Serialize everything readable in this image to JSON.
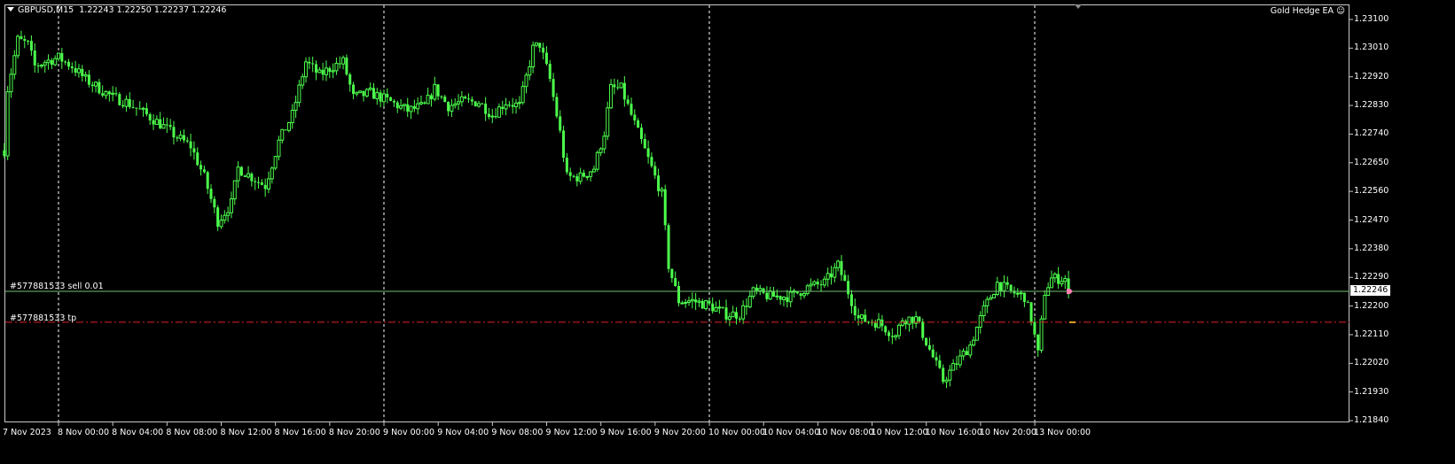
{
  "header": {
    "symbol_timeframe": "GBPUSD,M15",
    "ohlc": "1.22243 1.22250 1.22237 1.22246",
    "expert_name": "Gold Hedge EA",
    "expert_icon": "smiley-face-icon"
  },
  "colors": {
    "background": "#000000",
    "candle": "#4cff4c",
    "order_line": "#6fbf6f",
    "tp_line": "#e0202a",
    "grid_separator": "#ffffff"
  },
  "price_axis": {
    "labels": [
      "1.23100",
      "1.23010",
      "1.22920",
      "1.22830",
      "1.22740",
      "1.22650",
      "1.22560",
      "1.22470",
      "1.22380",
      "1.22290",
      "1.22200",
      "1.22110",
      "1.22020",
      "1.21930",
      "1.21840"
    ],
    "current_price": "1.22246",
    "range": [
      1.2184,
      1.231
    ]
  },
  "time_axis": {
    "labels": [
      "7 Nov 2023",
      "8 Nov 00:00",
      "8 Nov 04:00",
      "8 Nov 08:00",
      "8 Nov 12:00",
      "8 Nov 16:00",
      "8 Nov 20:00",
      "9 Nov 00:00",
      "9 Nov 04:00",
      "9 Nov 08:00",
      "9 Nov 12:00",
      "9 Nov 16:00",
      "9 Nov 20:00",
      "10 Nov 00:00",
      "10 Nov 04:00",
      "10 Nov 08:00",
      "10 Nov 12:00",
      "10 Nov 16:00",
      "10 Nov 20:00",
      "13 Nov 00:00"
    ],
    "day_separators": [
      "8 Nov 00:00",
      "9 Nov 00:00",
      "10 Nov 00:00",
      "13 Nov 00:00"
    ]
  },
  "orders": {
    "sell": {
      "label": "#577881533 sell 0.01",
      "price": 1.22246
    },
    "tp": {
      "label": "#577881533 tp",
      "price": 1.22149
    }
  },
  "chart_data": {
    "type": "candlestick",
    "timeframe": "M15",
    "approx_price_path": [
      [
        "7 20:00",
        1.22689
      ],
      [
        "7 20:15",
        1.22883
      ],
      [
        "7 21:00",
        1.23036
      ],
      [
        "7 21:45",
        1.23022
      ],
      [
        "7 22:15",
        1.22953
      ],
      [
        "7 23:00",
        1.22967
      ],
      [
        "8 00:00",
        1.2298
      ],
      [
        "8 01:00",
        1.22953
      ],
      [
        "8 02:00",
        1.22911
      ],
      [
        "8 03:00",
        1.22883
      ],
      [
        "8 04:00",
        1.22855
      ],
      [
        "8 05:00",
        1.22841
      ],
      [
        "8 06:00",
        1.22814
      ],
      [
        "8 07:30",
        1.22772
      ],
      [
        "8 08:45",
        1.2273
      ],
      [
        "8 09:45",
        1.22702
      ],
      [
        "8 10:45",
        1.22605
      ],
      [
        "8 11:45",
        1.22466
      ],
      [
        "8 12:45",
        1.22522
      ],
      [
        "8 13:15",
        1.22633
      ],
      [
        "8 14:15",
        1.22605
      ],
      [
        "8 15:15",
        1.22577
      ],
      [
        "8 16:15",
        1.22716
      ],
      [
        "8 17:15",
        1.228
      ],
      [
        "8 18:15",
        1.22967
      ],
      [
        "8 19:15",
        1.22925
      ],
      [
        "8 20:15",
        1.22953
      ],
      [
        "8 21:00",
        1.22967
      ],
      [
        "8 21:45",
        1.22855
      ],
      [
        "8 23:00",
        1.22869
      ],
      [
        "9 00:30",
        1.22841
      ],
      [
        "9 01:45",
        1.22814
      ],
      [
        "9 03:00",
        1.22828
      ],
      [
        "9 03:45",
        1.22883
      ],
      [
        "9 04:45",
        1.22828
      ],
      [
        "9 05:45",
        1.22841
      ],
      [
        "9 07:00",
        1.22841
      ],
      [
        "9 08:00",
        1.228
      ],
      [
        "9 09:00",
        1.22841
      ],
      [
        "9 10:00",
        1.22828
      ],
      [
        "9 11:00",
        1.23008
      ],
      [
        "9 11:30",
        1.23022
      ],
      [
        "9 12:15",
        1.22911
      ],
      [
        "9 13:00",
        1.22744
      ],
      [
        "9 13:30",
        1.22605
      ],
      [
        "9 14:30",
        1.22605
      ],
      [
        "9 15:30",
        1.22633
      ],
      [
        "9 16:15",
        1.22744
      ],
      [
        "9 16:45",
        1.22883
      ],
      [
        "9 17:30",
        1.22883
      ],
      [
        "9 18:30",
        1.22772
      ],
      [
        "9 19:30",
        1.22661
      ],
      [
        "9 20:30",
        1.2255
      ],
      [
        "9 21:00",
        1.22327
      ],
      [
        "9 21:45",
        1.22216
      ],
      [
        "9 22:45",
        1.22216
      ],
      [
        "10 00:00",
        1.22202
      ],
      [
        "10 01:15",
        1.22174
      ],
      [
        "10 02:15",
        1.22174
      ],
      [
        "10 03:15",
        1.22244
      ],
      [
        "10 04:30",
        1.2223
      ],
      [
        "10 06:00",
        1.2223
      ],
      [
        "10 07:15",
        1.22258
      ],
      [
        "10 08:30",
        1.22272
      ],
      [
        "10 09:30",
        1.22327
      ],
      [
        "10 10:00",
        1.22272
      ],
      [
        "10 11:00",
        1.2216
      ],
      [
        "10 12:30",
        1.22147
      ],
      [
        "10 13:45",
        1.22105
      ],
      [
        "10 14:15",
        1.2216
      ],
      [
        "10 15:15",
        1.2216
      ],
      [
        "10 16:15",
        1.22063
      ],
      [
        "10 17:15",
        1.21966
      ],
      [
        "10 18:15",
        1.22021
      ],
      [
        "10 19:15",
        1.22077
      ],
      [
        "10 20:15",
        1.22188
      ],
      [
        "10 21:15",
        1.22272
      ],
      [
        "10 22:15",
        1.22244
      ],
      [
        "10 23:15",
        1.2223
      ],
      [
        "10 23:45",
        1.2216
      ],
      [
        "13 00:15",
        1.22049
      ],
      [
        "13 00:45",
        1.22244
      ],
      [
        "13 01:15",
        1.22286
      ],
      [
        "13 02:15",
        1.22286
      ],
      [
        "13 02:30",
        1.22246
      ]
    ]
  }
}
